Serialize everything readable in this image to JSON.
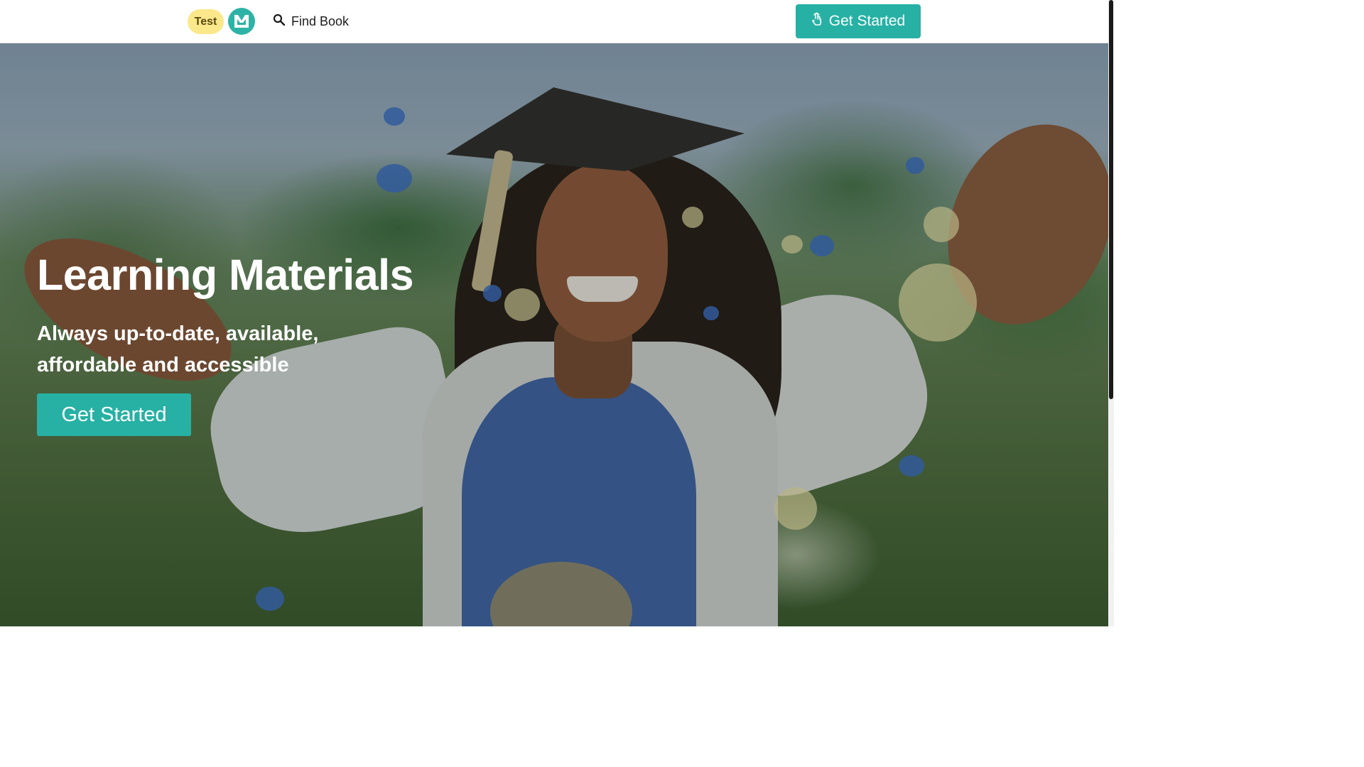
{
  "nav": {
    "badge": "Test",
    "find_book": "Find Book",
    "cta_label": "Get Started",
    "icons": {
      "logo": "lm-logo-icon",
      "search": "search-icon",
      "cta": "touch-hand-icon"
    }
  },
  "hero": {
    "title": "Learning Materials",
    "subtitle": "Always up-to-date, available, affordable and accessible",
    "cta_label": "Get Started",
    "background": "graduate-celebrating-confetti-photo"
  },
  "colors": {
    "accent": "#26b1a4",
    "badge_bg": "#fbe88a",
    "logo_bg": "#2db3a6",
    "text_light": "#ffffff"
  }
}
